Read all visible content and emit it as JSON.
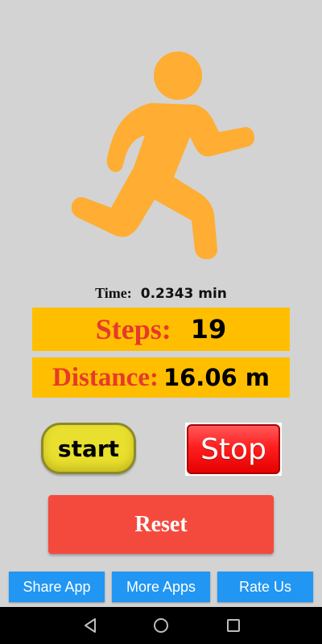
{
  "runner_icon": {
    "name": "running-person-icon",
    "color": "#ffad33"
  },
  "time": {
    "label": "Time:",
    "value": "0.2343 min"
  },
  "steps": {
    "label": "Steps:",
    "value": "19"
  },
  "distance": {
    "label": "Distance:",
    "value": "16.06 m"
  },
  "buttons": {
    "start": "start",
    "stop": "Stop",
    "reset": "Reset"
  },
  "bottom_buttons": {
    "share": "Share App",
    "more": "More Apps",
    "rate": "Rate Us"
  },
  "navbar": {
    "icons": [
      "back-icon",
      "home-icon",
      "recents-icon"
    ]
  },
  "colors": {
    "panel": "#ffbf00",
    "label_red": "#e63a2c",
    "reset": "#f44a3e",
    "bottom_button": "#2196f3",
    "background": "#d3d3d3"
  }
}
